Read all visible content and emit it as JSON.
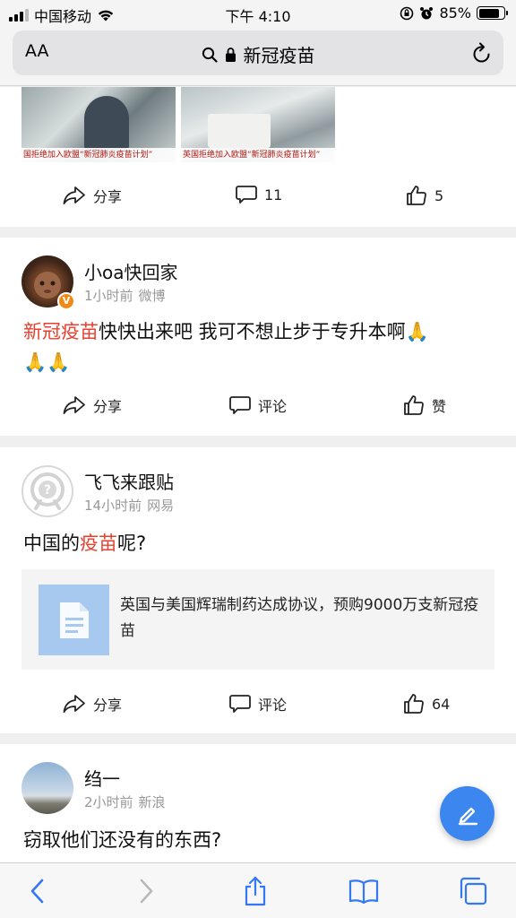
{
  "status_bar": {
    "carrier": "中国移动",
    "time": "下午 4:10",
    "battery_percent": "85%",
    "battery_level": 0.85,
    "icons": [
      "signal-icon",
      "wifi-icon",
      "orientation-lock-icon",
      "alarm-icon",
      "battery-icon"
    ]
  },
  "url_bar": {
    "text_size_label": "AA",
    "address": "新冠疫苗",
    "icons": [
      "search-icon",
      "lock-icon",
      "reload-icon"
    ]
  },
  "feed": {
    "post0": {
      "image_captions": [
        "国拒绝加入欧盟“新冠肺炎疫苗计划”",
        "英国拒绝加入欧盟“新冠肺炎疫苗计划”"
      ],
      "share": "分享",
      "comments": "11",
      "likes": "5"
    },
    "post1": {
      "username": "小oa快回家",
      "time": "1小时前",
      "source": "微博",
      "badge": "V",
      "text_highlight": "新冠疫苗",
      "text_line1_rest": "快快出来吧 我可不想止步于专升本啊🙏",
      "text_line2": "🙏🙏",
      "share": "分享",
      "comment": "评论",
      "like": "赞"
    },
    "post2": {
      "username": "飞飞来跟贴",
      "time": "14小时前",
      "source": "网易",
      "text_before": "中国的",
      "text_highlight": "疫苗",
      "text_after": "呢?",
      "link_title": "英国与美国辉瑞制药达成协议，预购9000万支新冠疫苗",
      "share": "分享",
      "comment": "评论",
      "likes": "64"
    },
    "post3": {
      "username": "绉一",
      "time": "2小时前",
      "source": "新浪",
      "text": "窃取他们还没有的东西?"
    }
  },
  "toolbar": {
    "icons": [
      "back-icon",
      "forward-icon",
      "share-icon",
      "bookmarks-icon",
      "tabs-icon"
    ]
  },
  "colors": {
    "accent": "#3c86ef",
    "highlight": "#e8402f",
    "verified_badge": "#f08a17",
    "ios_blue": "#3478f6"
  }
}
